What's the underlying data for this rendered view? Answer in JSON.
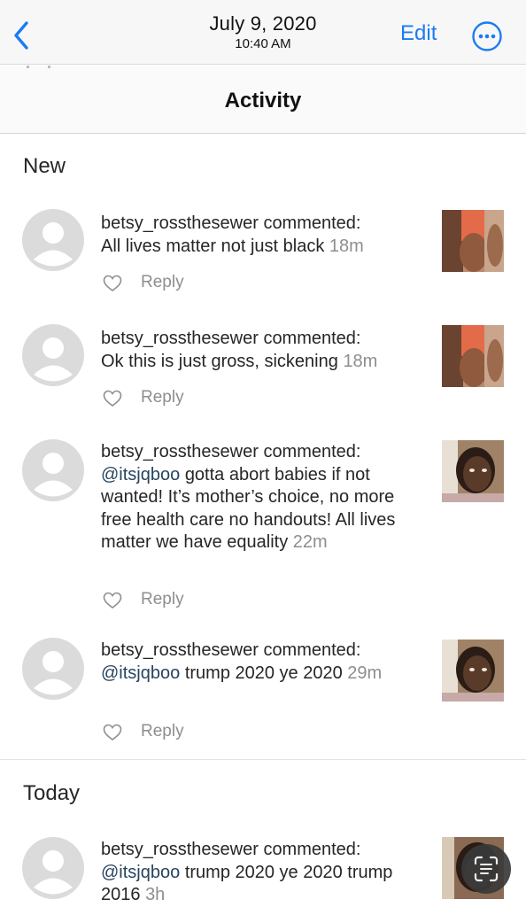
{
  "photos_bar": {
    "back_icon": "chevron-left-icon",
    "date": "July 9, 2020",
    "time": "10:40 AM",
    "edit_label": "Edit",
    "more_icon": "ellipsis-circle-icon",
    "accent": "#1a7cf3"
  },
  "activity": {
    "title": "Activity",
    "sections": [
      {
        "title": "New",
        "items": [
          {
            "user": "betsy_rossthesewer",
            "verb": "commented:",
            "mention": "",
            "text": "All lives matter not just black",
            "age": "18m",
            "reply_label": "Reply"
          },
          {
            "user": "betsy_rossthesewer",
            "verb": "commented:",
            "mention": "",
            "text": "Ok this is just gross, sickening",
            "age": "18m",
            "reply_label": "Reply"
          },
          {
            "user": "betsy_rossthesewer",
            "verb": "commented:",
            "mention": "@itsjqboo",
            "text": "gotta abort babies if not wanted! It’s mother’s choice, no more free health care no handouts! All lives matter we have equality",
            "age": "22m",
            "reply_label": "Reply"
          },
          {
            "user": "betsy_rossthesewer",
            "verb": "commented:",
            "mention": "@itsjqboo",
            "text": "trump 2020 ye 2020",
            "age": "29m",
            "reply_label": "Reply"
          }
        ]
      },
      {
        "title": "Today",
        "items": [
          {
            "user": "betsy_rossthesewer",
            "verb": "commented:",
            "mention": "@itsjqboo",
            "text": "trump 2020 ye 2020 trump 2016",
            "age": "3h",
            "reply_label": ""
          }
        ]
      }
    ]
  },
  "overlay": {
    "scan_icon": "live-text-scan-icon"
  }
}
